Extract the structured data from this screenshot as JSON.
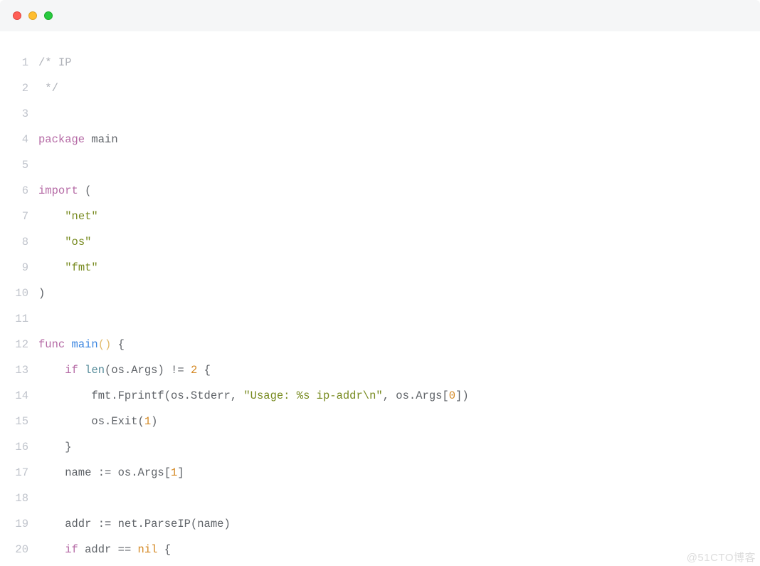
{
  "watermark": "@51CTO博客",
  "lines": [
    {
      "num": "1",
      "tokens": [
        {
          "cls": "c-comment",
          "text": "/* IP"
        }
      ]
    },
    {
      "num": "2",
      "tokens": [
        {
          "cls": "c-comment",
          "text": " */"
        }
      ]
    },
    {
      "num": "3",
      "tokens": []
    },
    {
      "num": "4",
      "tokens": [
        {
          "cls": "c-keyword",
          "text": "package"
        },
        {
          "cls": "c-plain",
          "text": " main"
        }
      ]
    },
    {
      "num": "5",
      "tokens": []
    },
    {
      "num": "6",
      "tokens": [
        {
          "cls": "c-keyword",
          "text": "import"
        },
        {
          "cls": "c-plain",
          "text": " ("
        }
      ]
    },
    {
      "num": "7",
      "tokens": [
        {
          "cls": "c-plain",
          "text": "    "
        },
        {
          "cls": "c-string",
          "text": "\"net\""
        }
      ]
    },
    {
      "num": "8",
      "tokens": [
        {
          "cls": "c-plain",
          "text": "    "
        },
        {
          "cls": "c-string",
          "text": "\"os\""
        }
      ]
    },
    {
      "num": "9",
      "tokens": [
        {
          "cls": "c-plain",
          "text": "    "
        },
        {
          "cls": "c-string",
          "text": "\"fmt\""
        }
      ]
    },
    {
      "num": "10",
      "tokens": [
        {
          "cls": "c-plain",
          "text": ")"
        }
      ]
    },
    {
      "num": "11",
      "tokens": []
    },
    {
      "num": "12",
      "tokens": [
        {
          "cls": "c-keyword",
          "text": "func"
        },
        {
          "cls": "c-plain",
          "text": " "
        },
        {
          "cls": "c-funcname",
          "text": "main"
        },
        {
          "cls": "c-paren",
          "text": "()"
        },
        {
          "cls": "c-plain",
          "text": " {"
        }
      ]
    },
    {
      "num": "13",
      "tokens": [
        {
          "cls": "c-plain",
          "text": "    "
        },
        {
          "cls": "c-keyword",
          "text": "if"
        },
        {
          "cls": "c-plain",
          "text": " "
        },
        {
          "cls": "c-builtin",
          "text": "len"
        },
        {
          "cls": "c-plain",
          "text": "(os.Args) != "
        },
        {
          "cls": "c-number",
          "text": "2"
        },
        {
          "cls": "c-plain",
          "text": " {"
        }
      ]
    },
    {
      "num": "14",
      "tokens": [
        {
          "cls": "c-plain",
          "text": "        fmt.Fprintf(os.Stderr, "
        },
        {
          "cls": "c-string",
          "text": "\"Usage: %s ip-addr\\n\""
        },
        {
          "cls": "c-plain",
          "text": ", os.Args["
        },
        {
          "cls": "c-number",
          "text": "0"
        },
        {
          "cls": "c-plain",
          "text": "])"
        }
      ]
    },
    {
      "num": "15",
      "tokens": [
        {
          "cls": "c-plain",
          "text": "        os.Exit("
        },
        {
          "cls": "c-number",
          "text": "1"
        },
        {
          "cls": "c-plain",
          "text": ")"
        }
      ]
    },
    {
      "num": "16",
      "tokens": [
        {
          "cls": "c-plain",
          "text": "    }"
        }
      ]
    },
    {
      "num": "17",
      "tokens": [
        {
          "cls": "c-plain",
          "text": "    name := os.Args["
        },
        {
          "cls": "c-number",
          "text": "1"
        },
        {
          "cls": "c-plain",
          "text": "]"
        }
      ]
    },
    {
      "num": "18",
      "tokens": []
    },
    {
      "num": "19",
      "tokens": [
        {
          "cls": "c-plain",
          "text": "    addr := net.ParseIP(name)"
        }
      ]
    },
    {
      "num": "20",
      "tokens": [
        {
          "cls": "c-plain",
          "text": "    "
        },
        {
          "cls": "c-keyword",
          "text": "if"
        },
        {
          "cls": "c-plain",
          "text": " addr == "
        },
        {
          "cls": "c-nil",
          "text": "nil"
        },
        {
          "cls": "c-plain",
          "text": " {"
        }
      ]
    }
  ]
}
